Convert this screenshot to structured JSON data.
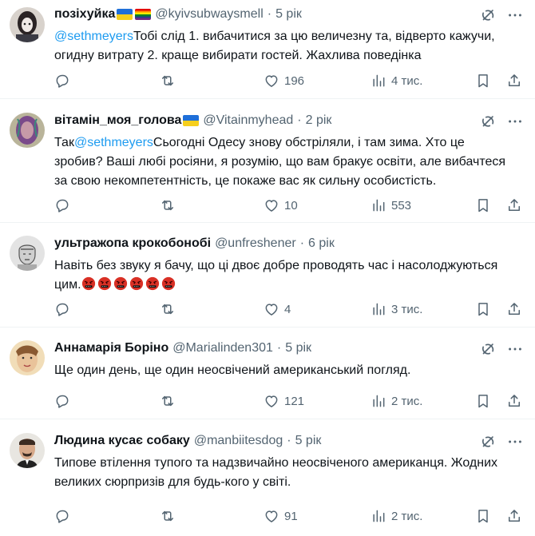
{
  "tweets": [
    {
      "name": "позіхуйка",
      "flags": [
        "ukraine-flag",
        "rainbow-flag"
      ],
      "handle": "@kyivsubwaysmell",
      "time": "5 рік",
      "mention": "@sethmeyers",
      "text_after_mention": "Тобі слід 1. вибачитися за цю величезну та, відверто кажучи, огидну витрату 2. краще вибирати гостей. Жахлива поведінка",
      "replies": "",
      "retweets": "",
      "likes": "196",
      "views": "4 тис."
    },
    {
      "name": "вітамін_моя_голова",
      "flags": [
        "ukraine-flag"
      ],
      "handle": "@Vitainmyhead",
      "time": "2 рік",
      "text_before_mention": "Так",
      "mention": "@sethmeyers",
      "text_after_mention": "Сьогодні Одесу знову обстріляли, і там зима. Хто це зробив? Ваші любі росіяни, я розумію, що вам бракує освіти, але вибачтеся за свою некомпетентність, це покаже вас як сильну особистість.",
      "replies": "",
      "retweets": "",
      "likes": "10",
      "views": "553"
    },
    {
      "name": "ультражопа крокобонобі",
      "handle": "@unfreshener",
      "time": "6 рік",
      "text": "Навіть без звуку я бачу, що ці двоє добре проводять час і насолоджуються цим.",
      "emojis": [
        "cursing-face-emoji",
        "cursing-face-emoji",
        "cursing-face-emoji",
        "cursing-face-emoji",
        "cursing-face-emoji",
        "cursing-face-emoji"
      ],
      "replies": "",
      "retweets": "",
      "likes": "4",
      "views": "3 тис."
    },
    {
      "name": "Аннамарія Боріно",
      "handle": "@Marialinden301",
      "time": "5 рік",
      "text": "Ще один день, ще один неосвічений американський погляд.",
      "replies": "",
      "retweets": "",
      "likes": "121",
      "views": "2 тис."
    },
    {
      "name": "Людина кусає собаку",
      "handle": "@manbiitesdog",
      "time": "5 рік",
      "text": "Типове втілення тупого та надзвичайно неосвіченого американця. Жодних великих сюрпризів для будь-кого у світі.",
      "replies": "",
      "retweets": "",
      "likes": "91",
      "views": "2 тис."
    }
  ],
  "colors": {
    "mention": "#1d9bf0",
    "secondary_text": "#536471",
    "divider": "#eff3f4"
  },
  "icons": [
    "grok-icon",
    "more-icon",
    "reply-icon",
    "retweet-icon",
    "like-icon",
    "views-icon",
    "bookmark-icon",
    "share-icon"
  ]
}
